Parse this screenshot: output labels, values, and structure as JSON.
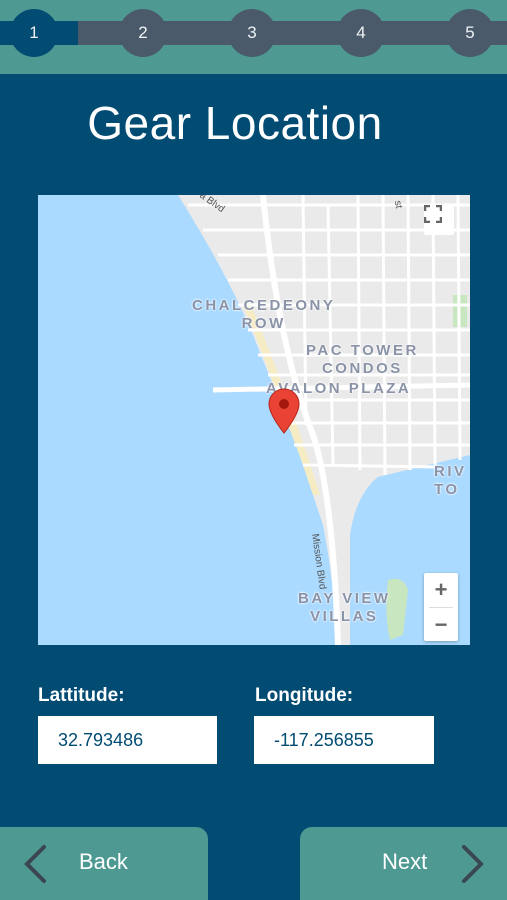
{
  "stepper": {
    "steps": [
      "1",
      "2",
      "3",
      "4",
      "5"
    ],
    "active_step": 1
  },
  "page": {
    "title": "Gear Location"
  },
  "map": {
    "labels": {
      "chalcedeony_row": "CHALCEDEONY\nROW",
      "pac_tower": "PAC TOWER\nCONDOS",
      "avalon_plaza": "AVALON PLAZA",
      "bay_view_villas": "BAY VIEW\nVILLAS",
      "riv_to": "RIV\nTO"
    },
    "road_labels": {
      "mission_blvd": "Mission Blvd",
      "top_blvd": "a Blvd",
      "top_st": "st"
    },
    "zoom_in": "+",
    "zoom_out": "−"
  },
  "coordinates": {
    "latitude_label": "Lattitude:",
    "latitude_value": "32.793486",
    "longitude_label": "Longitude:",
    "longitude_value": "-117.256855"
  },
  "nav": {
    "back_label": "Back",
    "next_label": "Next"
  },
  "colors": {
    "background": "#024b73",
    "accent": "#4e9a93",
    "step_inactive": "#4a5a6a",
    "pin": "#ea4335",
    "water": "#aadaff"
  }
}
